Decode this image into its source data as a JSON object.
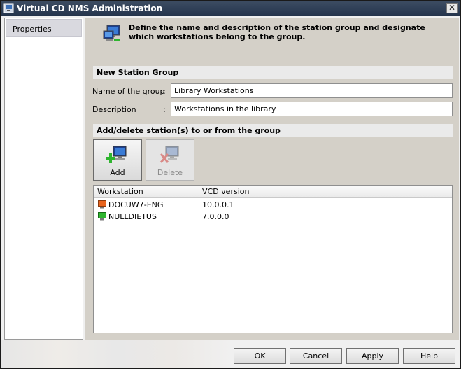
{
  "window": {
    "title": "Virtual CD NMS Administration",
    "close_label": "✕"
  },
  "sidebar": {
    "items": [
      {
        "label": "Properties"
      }
    ]
  },
  "header": {
    "description": "Define the name and description of the station group and designate which workstations belong to the group."
  },
  "group": {
    "section_title": "New Station Group",
    "name_label": "Name of the group",
    "name_value": "Library Workstations",
    "description_label": "Description",
    "description_value": "Workstations in the library",
    "colon": ":"
  },
  "stations": {
    "section_title": "Add/delete station(s) to or from the group",
    "add_label": "Add",
    "delete_label": "Delete",
    "columns": [
      "Workstation",
      "VCD version"
    ],
    "rows": [
      {
        "name": "DOCUW7-ENG",
        "version": "10.0.0.1",
        "status_color": "#e8641e"
      },
      {
        "name": "NULLDIETUS",
        "version": "7.0.0.0",
        "status_color": "#2fb52f"
      }
    ]
  },
  "footer": {
    "ok": "OK",
    "cancel": "Cancel",
    "apply": "Apply",
    "help": "Help"
  },
  "colors": {
    "titlebar": "#2f3f58",
    "panel": "#d4d0c8",
    "add_green": "#2fb52f",
    "delete_red": "#d9534f"
  }
}
